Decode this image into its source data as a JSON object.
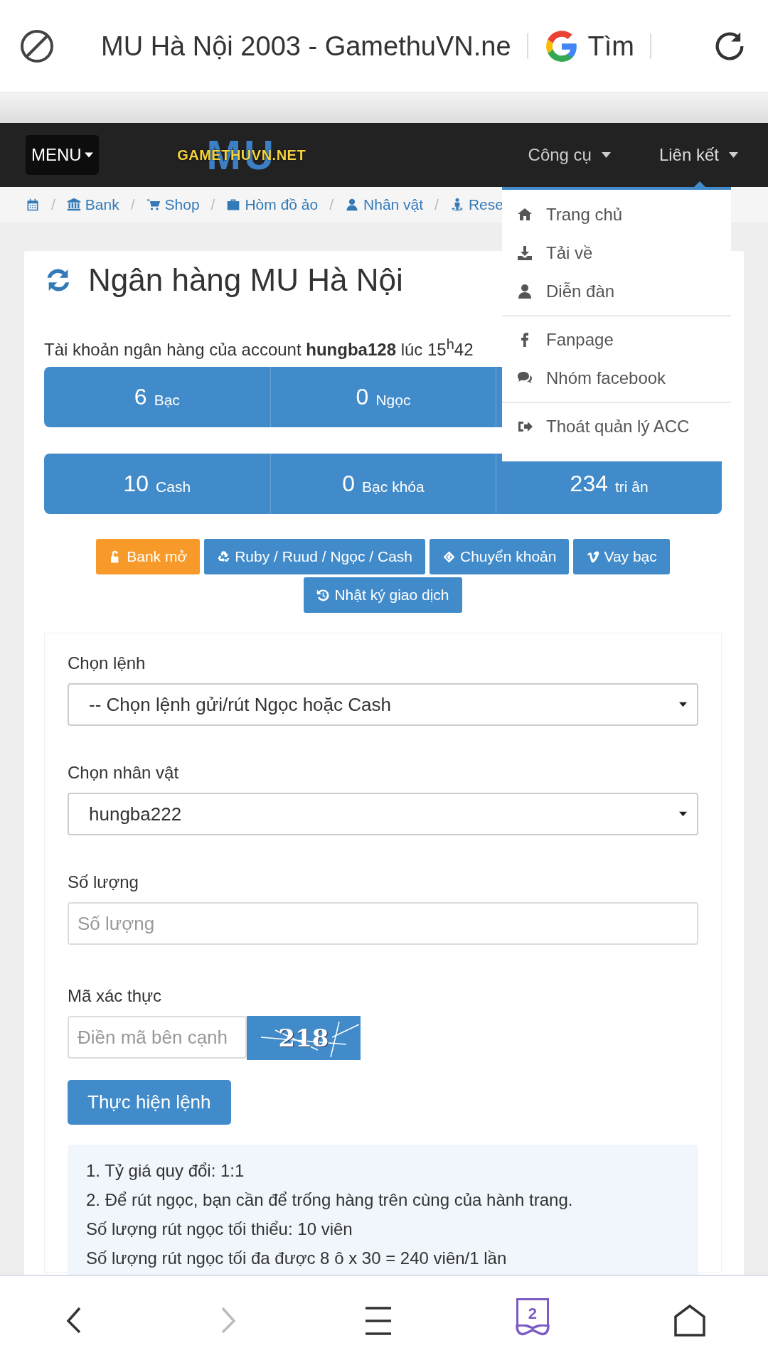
{
  "browser": {
    "title": "MU Hà Nội 2003 - GamethuVN.ne",
    "search_label": "Tìm"
  },
  "navbar": {
    "menu_button": "MENU",
    "logo": {
      "backdrop": "MU",
      "text": "GAMETHUVN.NET"
    },
    "items": [
      {
        "label": "Công cụ",
        "expanded": false
      },
      {
        "label": "Liên kết",
        "expanded": true,
        "dropdown": [
          {
            "kind": "home",
            "label": "Trang chủ"
          },
          {
            "kind": "download",
            "label": "Tải về"
          },
          {
            "kind": "user",
            "label": "Diễn đàn"
          },
          {
            "kind": "divider"
          },
          {
            "kind": "facebook",
            "label": "Fanpage"
          },
          {
            "kind": "comments",
            "label": "Nhóm facebook"
          },
          {
            "kind": "divider"
          },
          {
            "kind": "signout",
            "label": "Thoát quản lý ACC"
          }
        ]
      }
    ]
  },
  "breadcrumb": [
    {
      "kind": "calendar"
    },
    {
      "kind": "separator",
      "label": "/"
    },
    {
      "kind": "bank",
      "label": "Bank"
    },
    {
      "kind": "separator",
      "label": "/"
    },
    {
      "kind": "cart",
      "label": "Shop"
    },
    {
      "kind": "separator",
      "label": "/"
    },
    {
      "kind": "briefcase",
      "label": "Hòm đồ ảo"
    },
    {
      "kind": "separator",
      "label": "/"
    },
    {
      "kind": "user",
      "label": "Nhân vật"
    },
    {
      "kind": "separator",
      "label": "/"
    },
    {
      "kind": "person",
      "label": "Rese"
    }
  ],
  "page": {
    "title": "Ngân hàng MU Hà Nội",
    "account_line": "Tài khoản ngân hàng của account **hungba128** lúc 15$^{h}$42",
    "stat_rows": [
      [
        {
          "value": "6",
          "unit": "Bạc"
        },
        {
          "value": "0",
          "unit": "Ngọc"
        }
      ],
      [
        {
          "value": "10",
          "unit": "Cash"
        },
        {
          "value": "0",
          "unit": "Bạc khóa"
        },
        {
          "value": "234",
          "unit": "tri ân"
        }
      ]
    ],
    "actions": [
      {
        "kind": "unlock",
        "label": "Bank mở"
      },
      {
        "kind": "recycle",
        "label": "Ruby / Ruud / Ngọc / Cash"
      },
      {
        "kind": "exchange",
        "label": "Chuyển khoản"
      },
      {
        "kind": "vimeo",
        "label": "Vay bạc"
      },
      {
        "kind": "history",
        "label": "Nhật ký giao dịch"
      }
    ],
    "form": {
      "fields": [
        {
          "kind": "select",
          "label": "Chọn lệnh",
          "value": "-- Chọn lệnh gửi/rút Ngọc hoặc Cash"
        },
        {
          "kind": "select",
          "label": "Chọn nhân vật",
          "value": "hungba222"
        },
        {
          "kind": "input",
          "label": "Số lượng",
          "placeholder": "Số lượng"
        }
      ],
      "captcha": {
        "label": "Mã xác thực",
        "placeholder": "Điền mã bên cạnh",
        "code": "218"
      },
      "submit": "Thực hiện lệnh",
      "notes": [
        "1. Tỷ giá quy đổi: 1:1",
        "2. Để rút ngọc, bạn cần để trống hàng trên cùng của hành trang.",
        "Số lượng rút ngọc tối thiểu: 10 viên",
        "Số lượng rút ngọc tối đa được 8 ô x 30 = 240 viên/1 lần"
      ]
    }
  },
  "bottom_bar": {
    "forward_disabled": true,
    "tab_count": "2"
  }
}
